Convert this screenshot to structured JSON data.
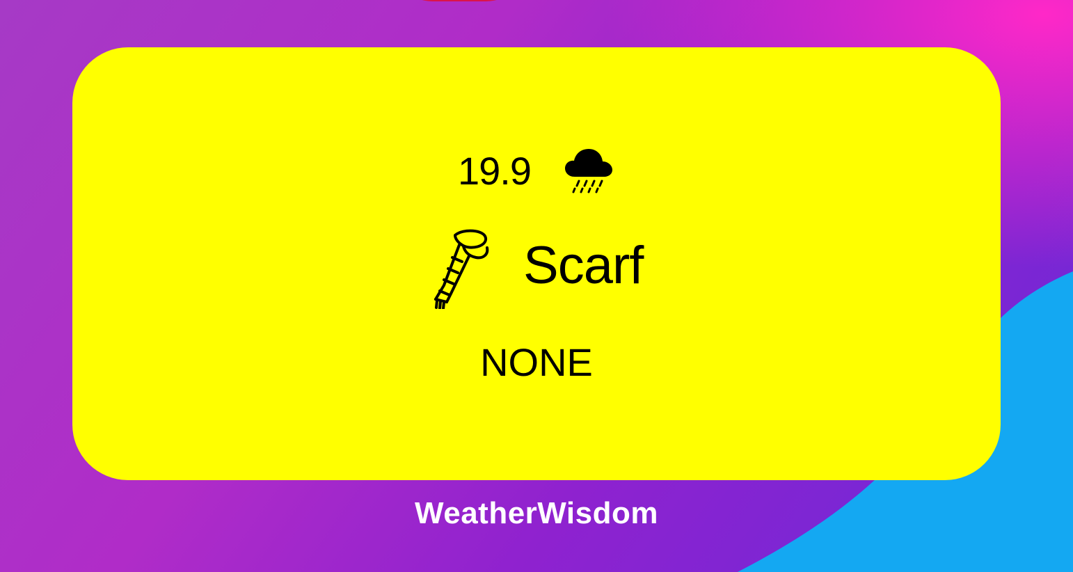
{
  "colors": {
    "widget_background": "#ffff00",
    "text": "#000000",
    "app_label": "#ffffff",
    "wallpaper_pink": "#ff28c8",
    "wallpaper_purple": "#8f22cf",
    "wallpaper_blue": "#14a8f2"
  },
  "widget": {
    "temperature": "19.9",
    "weather_icon": "cloud-rain-icon",
    "item_icon": "scarf-icon",
    "item_label": "Scarf",
    "status": "NONE"
  },
  "app": {
    "name": "WeatherWisdom"
  }
}
